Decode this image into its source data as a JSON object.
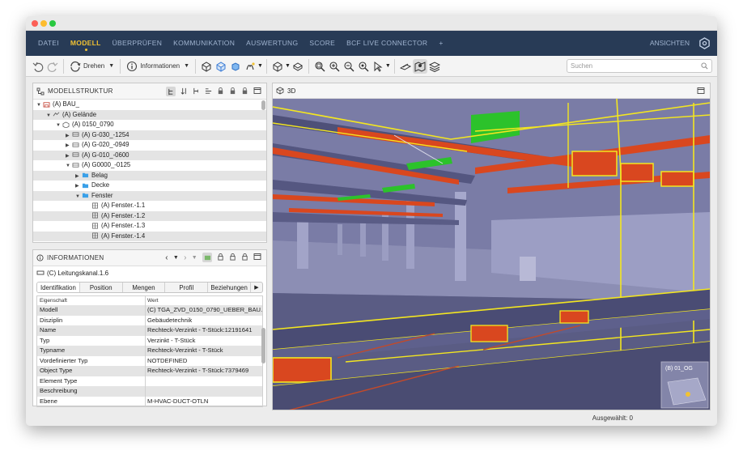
{
  "menu": {
    "items": [
      "DATEI",
      "MODELL",
      "ÜBERPRÜFEN",
      "KOMMUNIKATION",
      "AUSWERTUNG",
      "SCORE",
      "BCF LIVE CONNECTOR",
      "+"
    ],
    "active_index": 1,
    "right_label": "ANSICHTEN"
  },
  "toolbar": {
    "rotate_label": "Drehen",
    "info_label": "Informationen",
    "search_placeholder": "Suchen"
  },
  "model_tree": {
    "title": "MODELLSTRUKTUR",
    "rows": [
      {
        "indent": 0,
        "expander": "▼",
        "icon": "building-icon",
        "label": "(A) BAU_"
      },
      {
        "indent": 1,
        "expander": "▼",
        "icon": "terrain-icon",
        "label": "(A) Gelände"
      },
      {
        "indent": 2,
        "expander": "▼",
        "icon": "building-part-icon",
        "label": "(A) 0150_0790"
      },
      {
        "indent": 3,
        "expander": "▶",
        "icon": "storey-icon",
        "label": "(A) G-030_-1254"
      },
      {
        "indent": 3,
        "expander": "▶",
        "icon": "storey-icon",
        "label": "(A) G-020_-0949"
      },
      {
        "indent": 3,
        "expander": "▶",
        "icon": "storey-icon",
        "label": "(A) G-010_-0600"
      },
      {
        "indent": 3,
        "expander": "▼",
        "icon": "storey-icon",
        "label": "(A) G0000_-0125"
      },
      {
        "indent": 4,
        "expander": "▶",
        "icon": "folder-icon",
        "label": "Belag"
      },
      {
        "indent": 4,
        "expander": "▶",
        "icon": "folder-icon",
        "label": "Decke"
      },
      {
        "indent": 4,
        "expander": "▼",
        "icon": "folder-icon",
        "label": "Fenster"
      },
      {
        "indent": 5,
        "expander": "",
        "icon": "window-icon",
        "label": "(A) Fenster.-1.1"
      },
      {
        "indent": 5,
        "expander": "",
        "icon": "window-icon",
        "label": "(A) Fenster.-1.2"
      },
      {
        "indent": 5,
        "expander": "",
        "icon": "window-icon",
        "label": "(A) Fenster.-1.3"
      },
      {
        "indent": 5,
        "expander": "",
        "icon": "window-icon",
        "label": "(A) Fenster.-1.4"
      }
    ]
  },
  "info": {
    "title": "INFORMATIONEN",
    "object_label": "(C) Leitungskanal.1.6",
    "tabs": [
      "Identifikation",
      "Position",
      "Mengen",
      "Profil",
      "Beziehungen"
    ],
    "active_tab": 0,
    "columns": [
      "Eigenschaft",
      "Wert"
    ],
    "rows": [
      [
        "Modell",
        "(C) TGA_ZVD_0150_0790_UEBER_BAU..."
      ],
      [
        "Disziplin",
        "Gebäudetechnik"
      ],
      [
        "Name",
        "Rechteck-Verzinkt - T-Stück:12191641"
      ],
      [
        "Typ",
        "Verzinkt - T-Stück"
      ],
      [
        "Typname",
        "Rechteck-Verzinkt - T-Stück"
      ],
      [
        "Vordefinierter Typ",
        "NOTDEFINED"
      ],
      [
        "Object Type",
        "Rechteck-Verzinkt - T-Stück:7379469"
      ],
      [
        "Element Type",
        ""
      ],
      [
        "Beschreibung",
        ""
      ],
      [
        "Ebene",
        "M-HVAC-DUCT-OTLN"
      ]
    ]
  },
  "view": {
    "title": "3D",
    "minimap_label": "(B) 01_OG"
  },
  "status": {
    "selected": "Ausgewählt: 0"
  },
  "colors": {
    "menu_bg": "#283b56",
    "menu_active": "#f1c232",
    "scene_bg": "#6a6c96",
    "highlight_yellow": "#f3e620",
    "duct_orange": "#d9471f",
    "duct_green": "#2cc22b"
  }
}
